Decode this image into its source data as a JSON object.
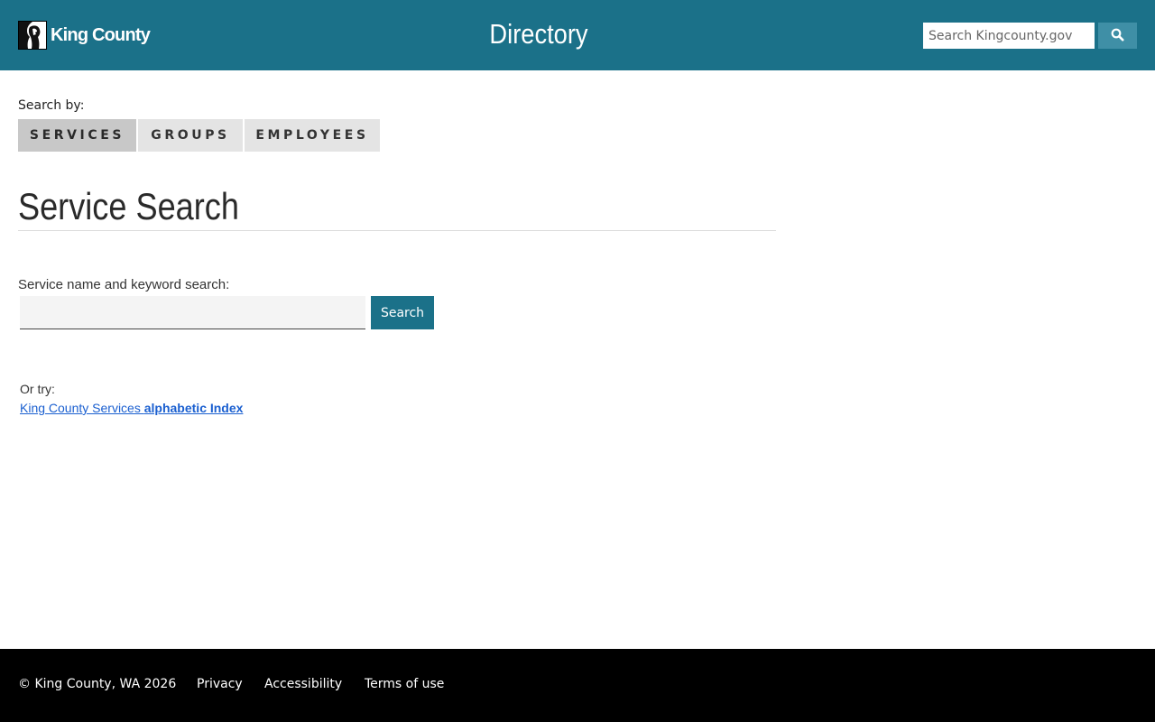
{
  "header": {
    "logo_text": "King County",
    "title": "Directory",
    "search_placeholder": "Search Kingcounty.gov",
    "search_icon": "search-icon"
  },
  "search_by": {
    "label": "Search by:",
    "tabs": [
      {
        "label": "SERVICES",
        "active": true
      },
      {
        "label": "GROUPS",
        "active": false
      },
      {
        "label": "EMPLOYEES",
        "active": false
      }
    ]
  },
  "main": {
    "title": "Service Search",
    "keyword_label": "Service name and keyword search:",
    "keyword_value": "",
    "search_button": "Search",
    "or_try": "Or try:",
    "index_link_part1": "King County Services ",
    "index_link_part2": "alphabetic Index"
  },
  "footer": {
    "copyright": "© King County, WA 2026",
    "links": [
      "Privacy",
      "Accessibility",
      "Terms of use"
    ]
  },
  "colors": {
    "brand_teal": "#1b7189",
    "footer_bg": "#000000",
    "link": "#1a5fd0"
  }
}
